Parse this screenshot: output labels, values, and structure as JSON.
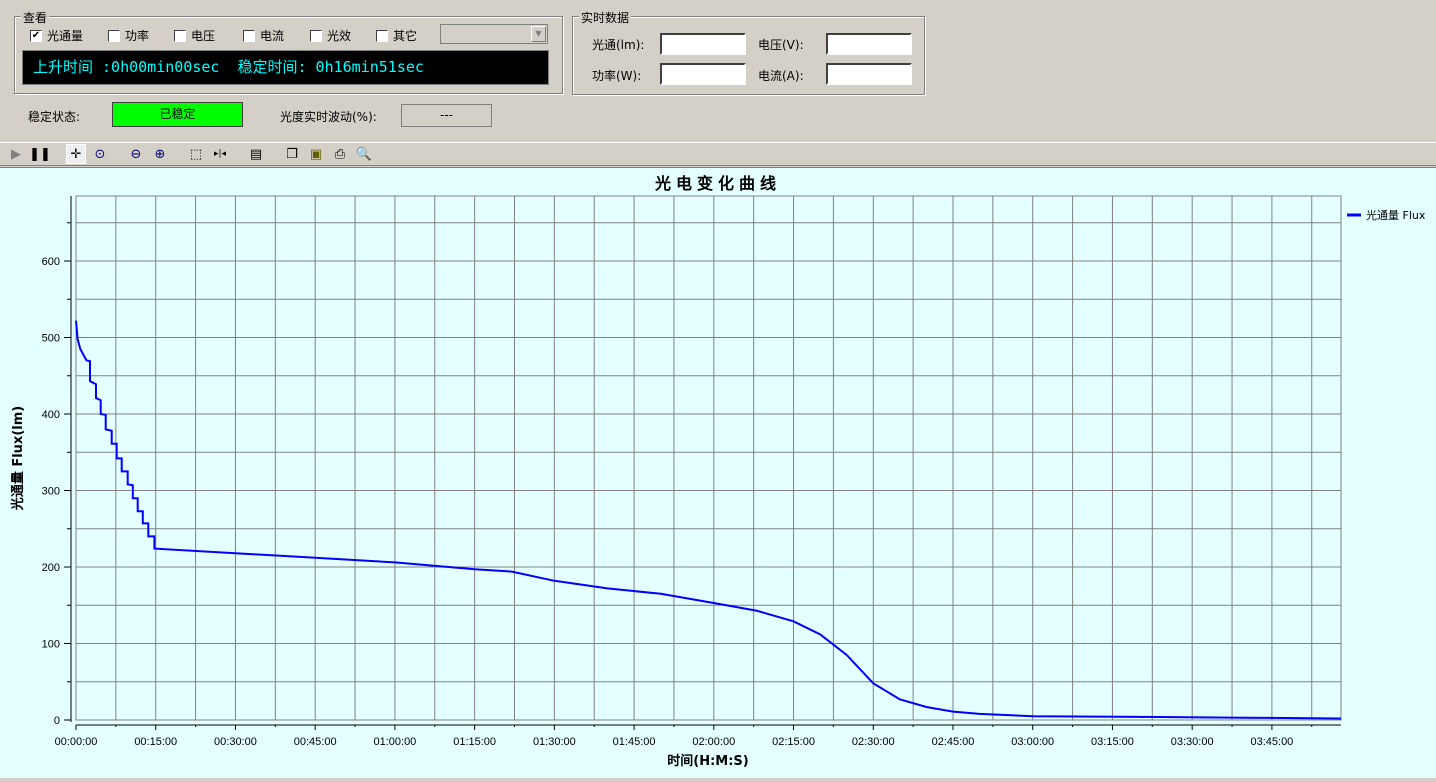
{
  "view_group": {
    "title": "查看",
    "checkboxes": [
      {
        "label": "光通量",
        "checked": true
      },
      {
        "label": "功率",
        "checked": false
      },
      {
        "label": "电压",
        "checked": false
      },
      {
        "label": "电流",
        "checked": false
      },
      {
        "label": "光效",
        "checked": false
      },
      {
        "label": "其它",
        "checked": false
      }
    ],
    "combo_value": "",
    "lcd_text": "上升时间 :0h00min00sec  稳定时间: 0h16min51sec"
  },
  "realtime_group": {
    "title": "实时数据",
    "fields": [
      {
        "label": "光通(lm):",
        "value": ""
      },
      {
        "label": "电压(V):",
        "value": ""
      },
      {
        "label": "功率(W):",
        "value": ""
      },
      {
        "label": "电流(A):",
        "value": ""
      }
    ]
  },
  "status": {
    "label": "稳定状态:",
    "value": "已稳定",
    "color": "#00ff00",
    "fluctuation_label": "光度实时波动(%):",
    "fluctuation_value": "---"
  },
  "toolbar": [
    "play-icon",
    "pause-icon",
    "pan-icon",
    "zoom-fit-icon",
    "zoom-out-icon",
    "zoom-in-icon",
    "select-rect-icon",
    "cursor-icon",
    "properties-icon",
    "copy-icon",
    "save-icon",
    "print-icon",
    "print-preview-icon"
  ],
  "chart_data": {
    "type": "line",
    "title": "光电变化曲线",
    "xlabel": "时间(H:M:S)",
    "ylabel": "光通量 Flux(lm)",
    "xlim": [
      "00:00:00",
      "03:58:00"
    ],
    "ylim": [
      0,
      685
    ],
    "x_ticks": [
      "00:00:00",
      "00:15:00",
      "00:30:00",
      "00:45:00",
      "01:00:00",
      "01:15:00",
      "01:30:00",
      "01:45:00",
      "02:00:00",
      "02:15:00",
      "02:30:00",
      "02:45:00",
      "03:00:00",
      "03:15:00",
      "03:30:00",
      "03:45:00"
    ],
    "y_ticks": [
      0,
      100,
      200,
      300,
      400,
      500,
      600
    ],
    "grid": true,
    "legend_position": "right",
    "series": [
      {
        "name": "光通量 Flux",
        "color": "#0000ff",
        "points": [
          [
            "00:00:00",
            522
          ],
          [
            "00:00:18",
            498
          ],
          [
            "00:00:48",
            485
          ],
          [
            "00:01:30",
            476
          ],
          [
            "00:02:00",
            470
          ],
          [
            "00:02:38",
            469
          ],
          [
            "00:02:38",
            443
          ],
          [
            "00:03:46",
            439
          ],
          [
            "00:03:46",
            421
          ],
          [
            "00:04:39",
            418
          ],
          [
            "00:04:39",
            400
          ],
          [
            "00:05:35",
            399
          ],
          [
            "00:05:35",
            380
          ],
          [
            "00:06:43",
            378
          ],
          [
            "00:06:43",
            361
          ],
          [
            "00:07:40",
            361
          ],
          [
            "00:07:40",
            342
          ],
          [
            "00:08:36",
            342
          ],
          [
            "00:08:36",
            325
          ],
          [
            "00:09:44",
            325
          ],
          [
            "00:09:44",
            308
          ],
          [
            "00:10:41",
            307
          ],
          [
            "00:10:41",
            290
          ],
          [
            "00:11:37",
            290
          ],
          [
            "00:11:37",
            273
          ],
          [
            "00:12:34",
            273
          ],
          [
            "00:12:34",
            257
          ],
          [
            "00:13:36",
            257
          ],
          [
            "00:13:36",
            240
          ],
          [
            "00:14:45",
            240
          ],
          [
            "00:14:45",
            224
          ],
          [
            "00:30:00",
            218
          ],
          [
            "00:45:00",
            212
          ],
          [
            "01:00:00",
            206
          ],
          [
            "01:15:00",
            197
          ],
          [
            "01:22:00",
            194
          ],
          [
            "01:30:00",
            182
          ],
          [
            "01:40:00",
            172
          ],
          [
            "01:50:00",
            165
          ],
          [
            "02:00:00",
            153
          ],
          [
            "02:08:00",
            143
          ],
          [
            "02:15:00",
            129
          ],
          [
            "02:20:00",
            112
          ],
          [
            "02:25:00",
            85
          ],
          [
            "02:30:00",
            48
          ],
          [
            "02:35:00",
            27
          ],
          [
            "02:40:00",
            17
          ],
          [
            "02:45:00",
            11
          ],
          [
            "02:50:00",
            8
          ],
          [
            "03:00:00",
            5
          ],
          [
            "03:20:00",
            4
          ],
          [
            "03:40:00",
            3
          ],
          [
            "03:58:00",
            2
          ]
        ]
      }
    ]
  }
}
